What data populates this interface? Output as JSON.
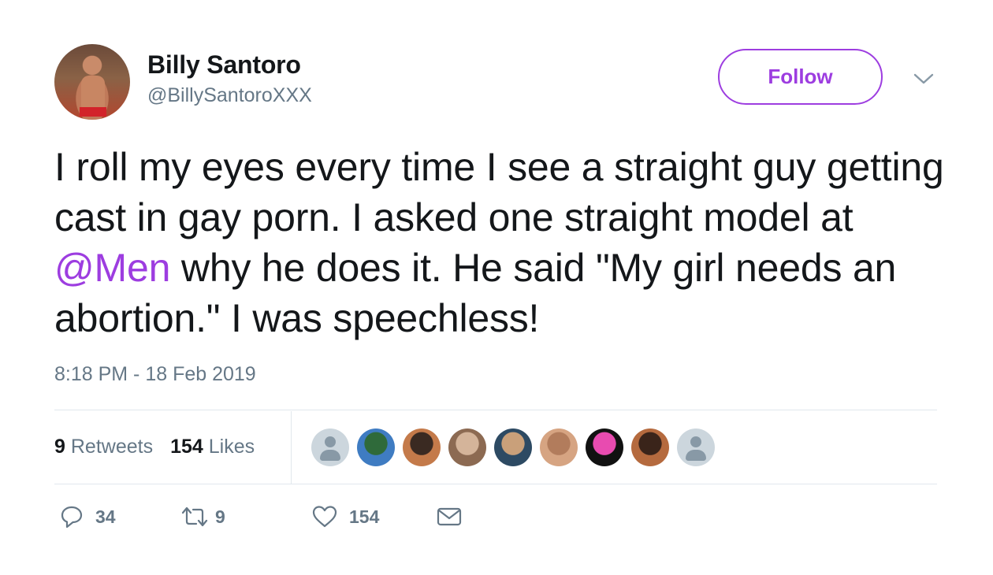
{
  "author": {
    "name": "Billy Santoro",
    "handle": "@BillySantoroXXX"
  },
  "follow_label": "Follow",
  "tweet": {
    "text_before": "I roll my eyes every time I see a straight guy getting cast in gay porn. I asked one straight model at ",
    "mention": "@Men",
    "text_after": " why he does it.  He said \"My girl needs an abortion.\"  I was speechless!"
  },
  "timestamp": "8:18 PM - 18 Feb 2019",
  "stats": {
    "retweet_count": "9",
    "retweet_label": "Retweets",
    "like_count": "154",
    "like_label": "Likes"
  },
  "liker_avatars": [
    {
      "type": "default-avatar"
    },
    {
      "type": "photo",
      "colors": [
        "#3f7cc2",
        "#2f6a3a"
      ]
    },
    {
      "type": "photo",
      "colors": [
        "#c47a4a",
        "#3a2a22"
      ]
    },
    {
      "type": "photo",
      "colors": [
        "#8c6a52",
        "#d4b49a"
      ]
    },
    {
      "type": "photo",
      "colors": [
        "#2d4a63",
        "#c9a07a"
      ]
    },
    {
      "type": "photo",
      "colors": [
        "#d6a482",
        "#b27c5c"
      ]
    },
    {
      "type": "photo",
      "colors": [
        "#111111",
        "#e84bb0"
      ]
    },
    {
      "type": "photo",
      "colors": [
        "#b56a3e",
        "#3a241a"
      ]
    },
    {
      "type": "default-avatar"
    }
  ],
  "actions": {
    "reply_count": "34",
    "retweet_count": "9",
    "like_count": "154"
  },
  "icons": [
    "reply-icon",
    "retweet-icon",
    "heart-icon",
    "envelope-icon",
    "chevron-down-icon"
  ],
  "colors": {
    "accent": "#9d3de0",
    "secondary_text": "#657786",
    "divider": "#e1e8ed"
  }
}
